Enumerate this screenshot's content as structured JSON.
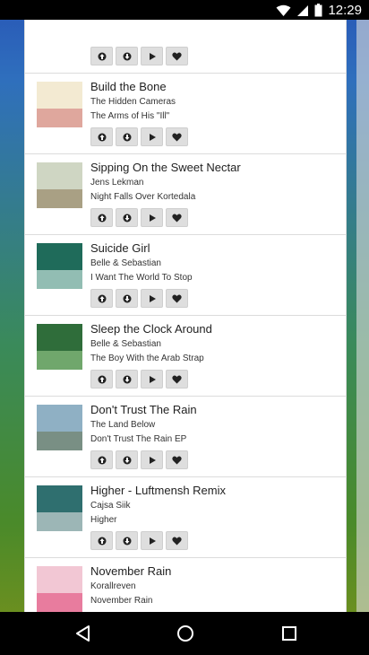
{
  "status_bar": {
    "time": "12:29",
    "icons": [
      "wifi-icon",
      "signal-icon",
      "battery-icon"
    ]
  },
  "tracks": [
    {
      "title": "",
      "artist": "",
      "album": "",
      "cover_colors": [
        "#ffffff",
        "#ffffff"
      ]
    },
    {
      "title": "Build the Bone",
      "artist": "The Hidden Cameras",
      "album": "The Arms of His \"Ill\"",
      "cover_colors": [
        "#f3ead2",
        "#d27a7a"
      ]
    },
    {
      "title": "Sipping On the Sweet Nectar",
      "artist": "Jens Lekman",
      "album": "Night Falls Over Kortedala",
      "cover_colors": [
        "#cfd6c3",
        "#8f7b5a"
      ]
    },
    {
      "title": "Suicide Girl",
      "artist": "Belle & Sebastian",
      "album": "I Want The World To Stop",
      "cover_colors": [
        "#1f6b5a",
        "#dff4ee"
      ]
    },
    {
      "title": "Sleep the Clock Around",
      "artist": "Belle & Sebastian",
      "album": "The Boy With the Arab Strap",
      "cover_colors": [
        "#2f6d3a",
        "#9ccf8d"
      ]
    },
    {
      "title": "Don't Trust The Rain",
      "artist": "The Land Below",
      "album": "Don't Trust The Rain EP",
      "cover_colors": [
        "#8fb0c4",
        "#6a7a5a"
      ]
    },
    {
      "title": "Higher - Luftmensh Remix",
      "artist": "Cajsa Siik",
      "album": "Higher",
      "cover_colors": [
        "#2f6f6f",
        "#e6e6e6"
      ]
    },
    {
      "title": "November Rain",
      "artist": "Korallreven",
      "album": "November Rain",
      "cover_colors": [
        "#f2c7d4",
        "#e14a7a"
      ]
    }
  ],
  "actions": [
    "upvote",
    "downvote",
    "play",
    "favorite"
  ],
  "nav_bar": {
    "icons": [
      "back-icon",
      "home-icon",
      "recents-icon"
    ]
  }
}
